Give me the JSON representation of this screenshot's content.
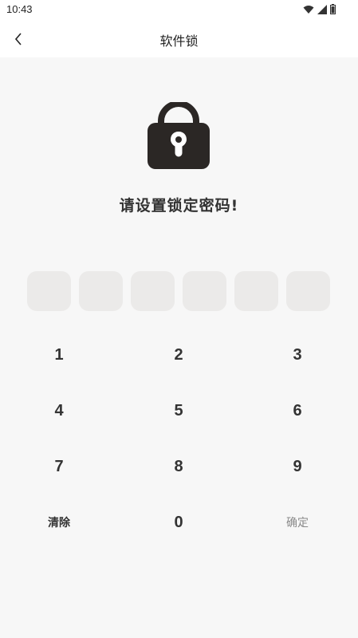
{
  "status_bar": {
    "time": "10:43",
    "icons": [
      "wifi-icon",
      "signal-icon",
      "battery-icon"
    ]
  },
  "nav": {
    "title": "软件锁",
    "back_icon": "chevron-left-icon"
  },
  "lock": {
    "icon": "padlock-icon",
    "color": "#2b2725"
  },
  "prompt": "请设置锁定密码!",
  "pin_boxes": 6,
  "keypad": {
    "keys": [
      "1",
      "2",
      "3",
      "4",
      "5",
      "6",
      "7",
      "8",
      "9"
    ],
    "clear_label": "清除",
    "zero_label": "0",
    "confirm_label": "确定"
  }
}
